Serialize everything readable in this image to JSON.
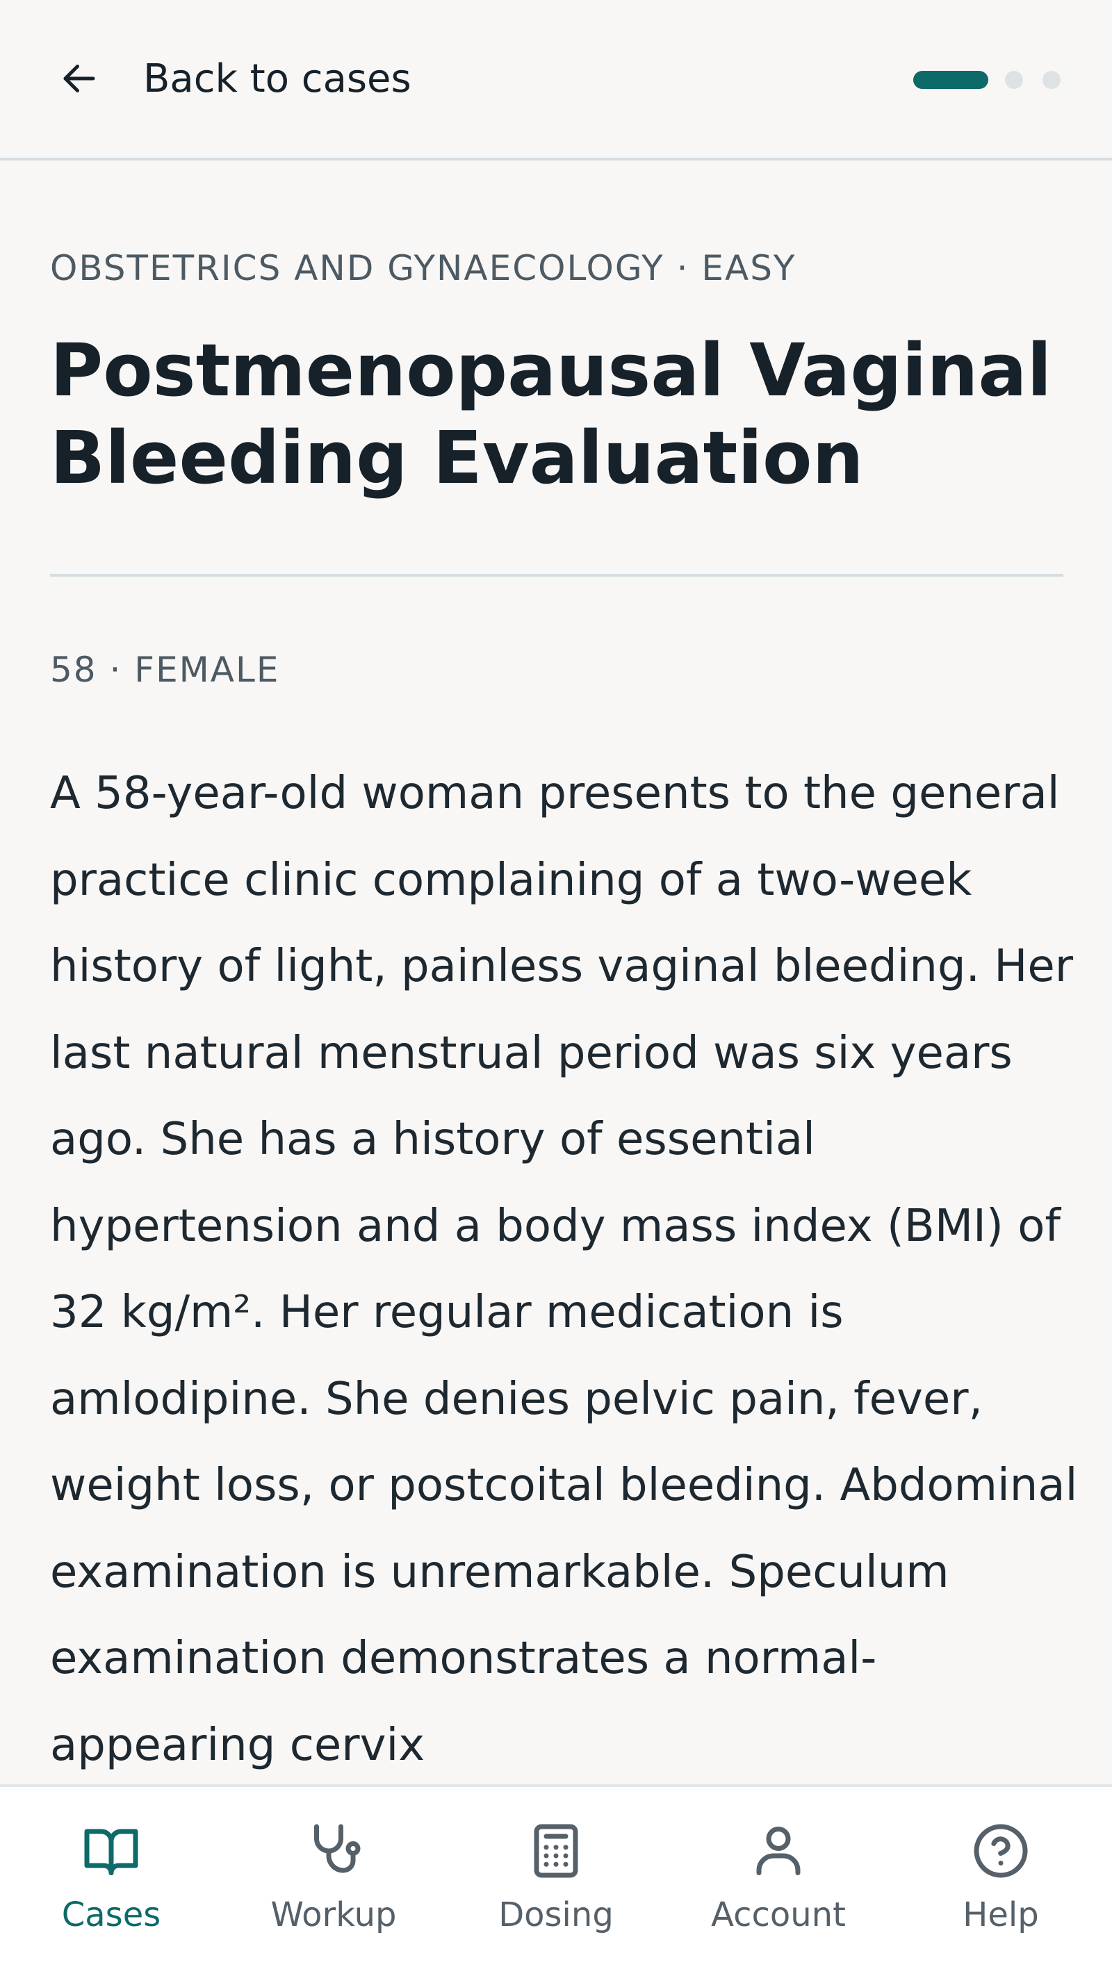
{
  "header": {
    "back_label": "Back to cases",
    "progress": {
      "current_step": 1,
      "total_steps": 3
    }
  },
  "case": {
    "category": "OBSTETRICS AND GYNAECOLOGY · EASY",
    "title": "Postmenopausal Vaginal Bleeding Evaluation",
    "demographics": "58 · FEMALE",
    "vignette": "A 58-year-old woman presents to the general practice clinic complaining of a two-week history of light, painless vaginal bleeding. Her last natural menstrual period was six years ago. She has a history of essential hypertension and a body mass index (BMI) of 32 kg/m². Her regular medication is amlodipine. She denies pelvic pain, fever, weight loss, or postcoital bleeding. Abdominal examination is unremarkable. Speculum examination demonstrates a normal-appearing cervix"
  },
  "nav": {
    "items": [
      {
        "label": "Cases",
        "icon": "book-open-icon",
        "active": true
      },
      {
        "label": "Workup",
        "icon": "stethoscope-icon",
        "active": false
      },
      {
        "label": "Dosing",
        "icon": "calculator-icon",
        "active": false
      },
      {
        "label": "Account",
        "icon": "user-icon",
        "active": false
      },
      {
        "label": "Help",
        "icon": "help-circle-icon",
        "active": false
      }
    ]
  },
  "colors": {
    "accent": "#0c6a69",
    "background": "#f8f7f5",
    "text": "#17212a",
    "muted": "#4d5a63",
    "divider": "#d6dde0",
    "nav_inactive": "#566069"
  }
}
